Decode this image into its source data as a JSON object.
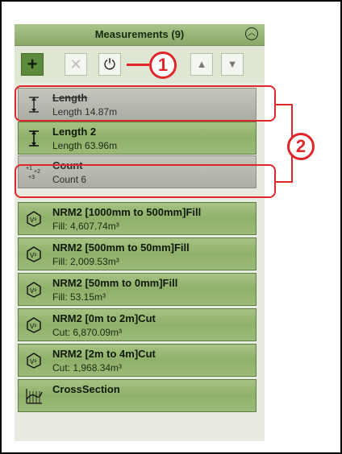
{
  "panel": {
    "title": "Measurements (9)",
    "collapse_icon": "chevron-up-circle-icon"
  },
  "toolbar": {
    "add_label": "+",
    "delete_label": "✕",
    "power_label": "⏻",
    "up_label": "▲",
    "down_label": "▼"
  },
  "items": [
    {
      "name": "Length",
      "sub": "Length 14.87m",
      "icon": "length-icon",
      "disabled": true
    },
    {
      "name": "Length 2",
      "sub": "Length 63.96m",
      "icon": "length-icon",
      "disabled": false
    },
    {
      "name": "Count",
      "sub": "Count 6",
      "icon": "count-icon",
      "disabled": true
    },
    {
      "name": "NRM2 [1000mm to 500mm]Fill",
      "sub": "Fill: 4,607.74m³",
      "icon": "volume-icon",
      "disabled": false
    },
    {
      "name": "NRM2 [500mm to 50mm]Fill",
      "sub": "Fill: 2,009.53m³",
      "icon": "volume-icon",
      "disabled": false
    },
    {
      "name": "NRM2 [50mm to 0mm]Fill",
      "sub": "Fill: 53.15m³",
      "icon": "volume-icon",
      "disabled": false
    },
    {
      "name": "NRM2 [0m to 2m]Cut",
      "sub": "Cut: 6,870.09m³",
      "icon": "volume-icon",
      "disabled": false
    },
    {
      "name": "NRM2 [2m to 4m]Cut",
      "sub": "Cut: 1,968.34m³",
      "icon": "volume-icon",
      "disabled": false
    },
    {
      "name": "CrossSection",
      "sub": "",
      "icon": "cross-section-icon",
      "disabled": false
    }
  ],
  "callouts": {
    "one": "1",
    "two": "2"
  },
  "colors": {
    "accent_red": "#e0262a",
    "item_green": "#8fb06a",
    "disabled_gray": "#a9ada2"
  }
}
